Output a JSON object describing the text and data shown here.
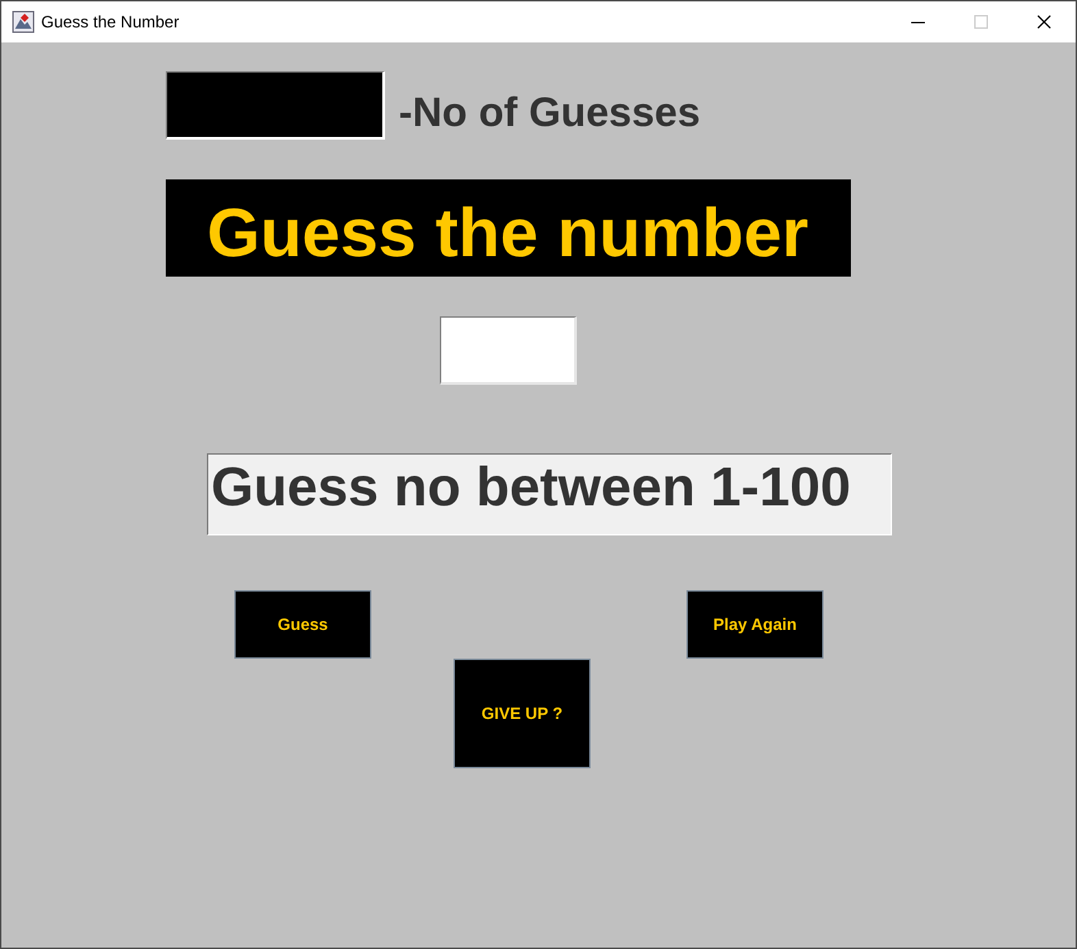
{
  "window": {
    "title": "Guess the Number",
    "controls": [
      {
        "kind": "minimize",
        "disabled": false
      },
      {
        "kind": "maximize",
        "disabled": true
      },
      {
        "kind": "close",
        "disabled": false
      }
    ]
  },
  "counter": {
    "label": "-No of Guesses"
  },
  "banner": {
    "title": "Guess the number"
  },
  "message": {
    "value": "Guess no between 1-100"
  },
  "buttons": [
    {
      "label": "Guess"
    },
    {
      "label": "Play Again"
    },
    {
      "label": "GIVE UP ?"
    }
  ]
}
